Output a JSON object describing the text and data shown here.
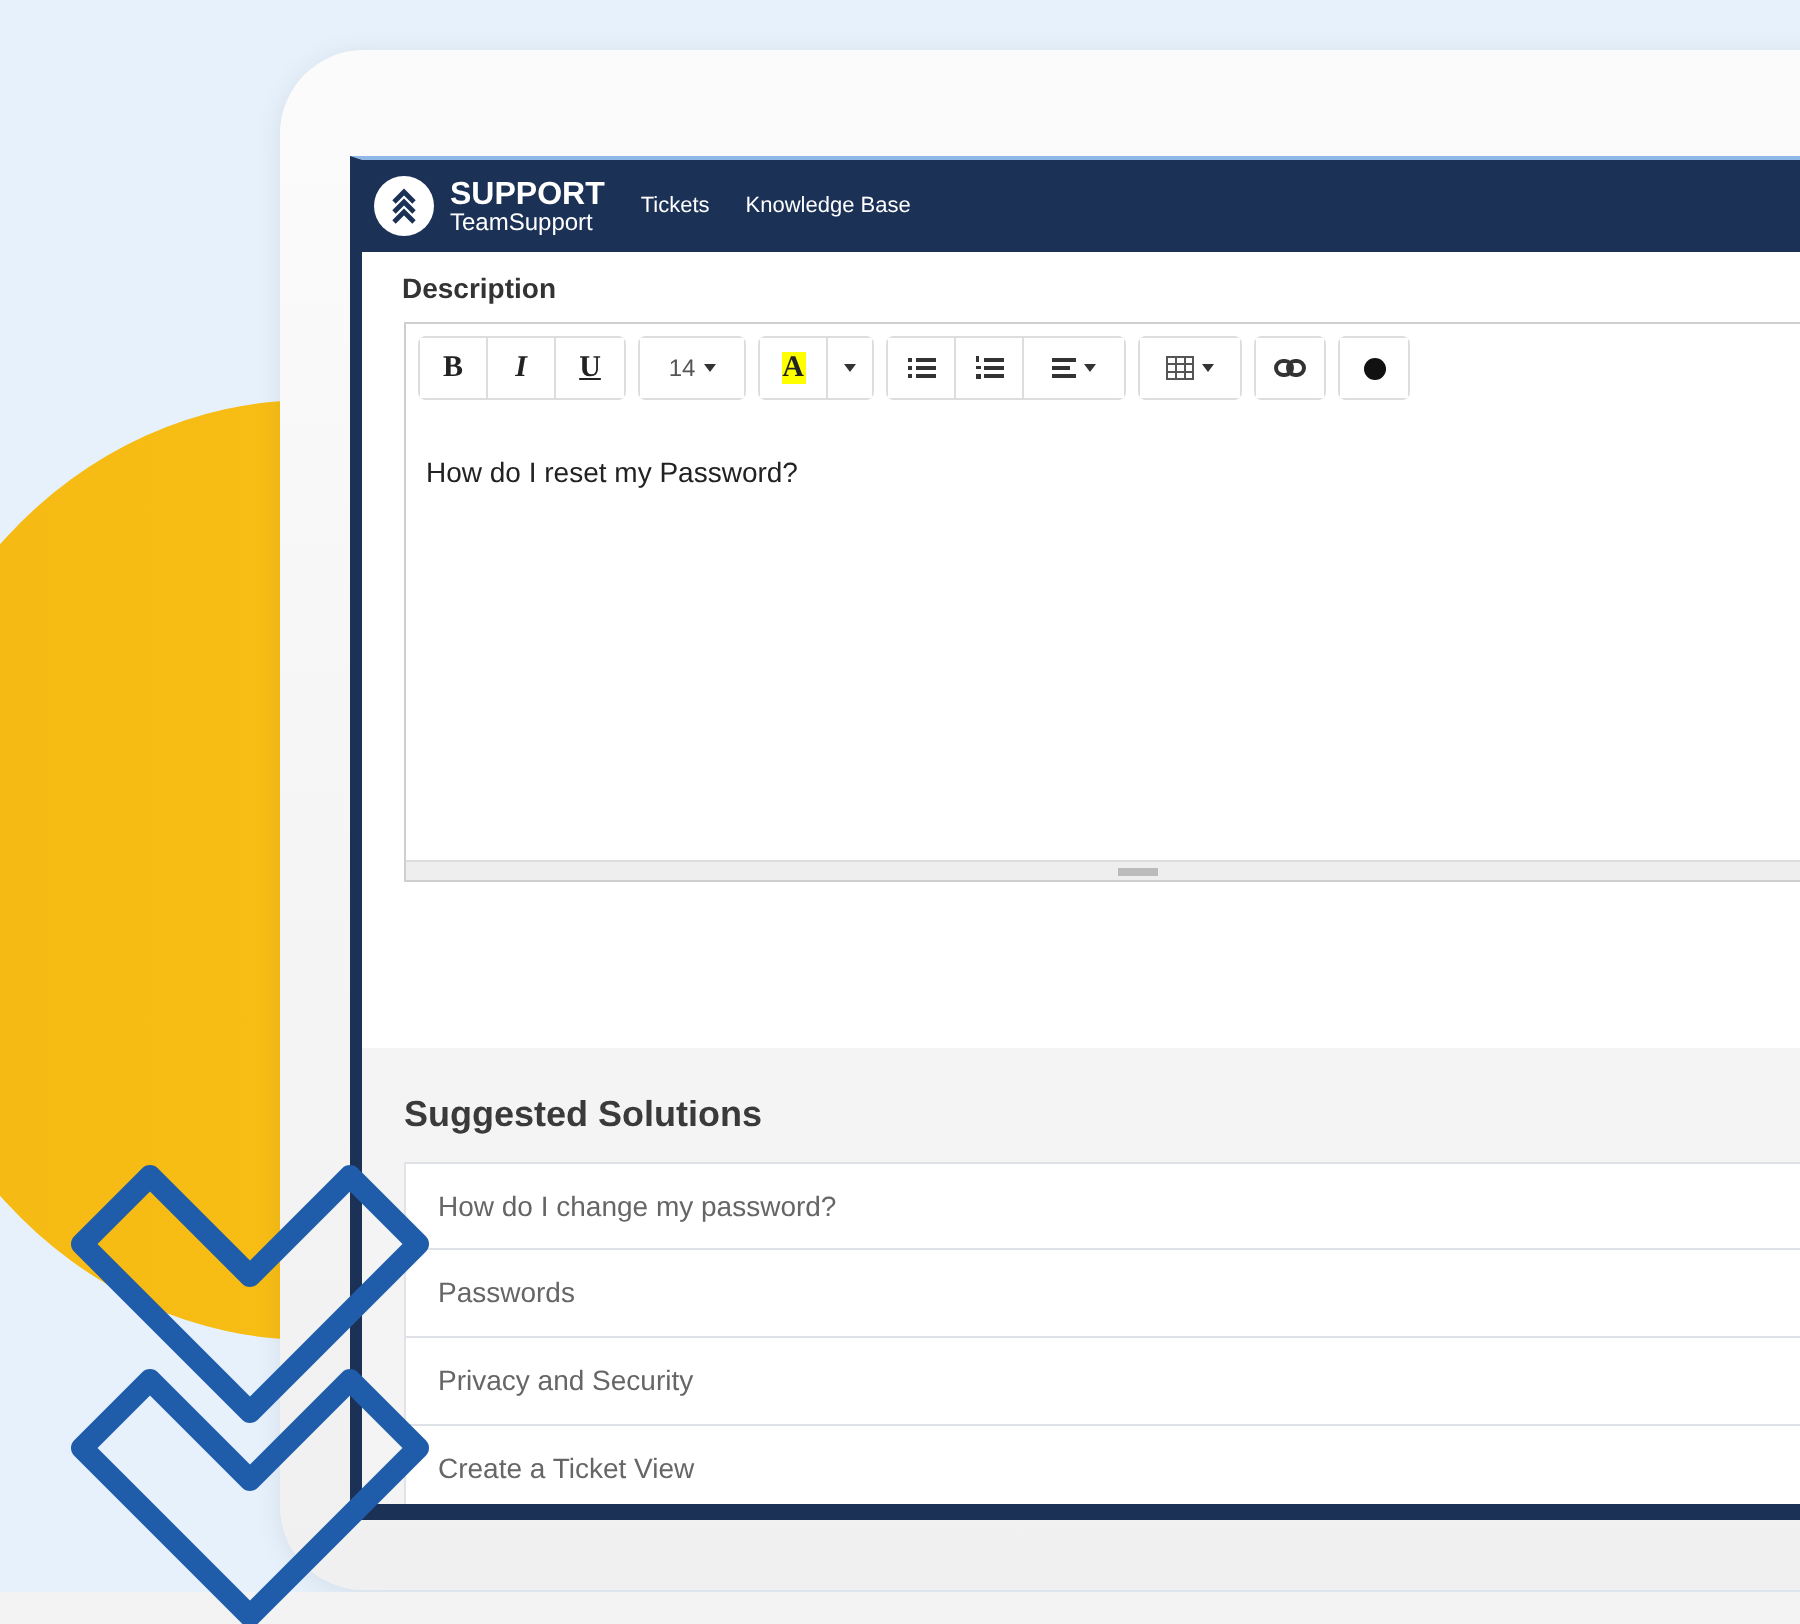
{
  "navbar": {
    "brand": {
      "name": "SUPPORT",
      "sub": "TeamSupport"
    },
    "links": [
      {
        "label": "Tickets"
      },
      {
        "label": "Knowledge Base"
      }
    ]
  },
  "description": {
    "label": "Description",
    "toolbar": [
      {
        "buttons": [
          {
            "kind": "bold",
            "label": "B"
          },
          {
            "kind": "italic",
            "label": "I"
          },
          {
            "kind": "underline",
            "label": "U"
          }
        ]
      },
      {
        "buttons": [
          {
            "kind": "size",
            "label": "14"
          }
        ]
      },
      {
        "buttons": [
          {
            "kind": "color",
            "label": "A",
            "color": "#ffff00"
          },
          {
            "kind": "caret"
          }
        ]
      },
      {
        "buttons": [
          {
            "kind": "bullets"
          },
          {
            "kind": "numbers"
          },
          {
            "kind": "align"
          }
        ]
      },
      {
        "buttons": [
          {
            "kind": "table"
          }
        ]
      },
      {
        "buttons": [
          {
            "kind": "link"
          }
        ]
      },
      {
        "buttons": [
          {
            "kind": "record"
          }
        ]
      }
    ],
    "value": "How do I reset my Password?"
  },
  "suggested_solutions": {
    "title": "Suggested Solutions",
    "items": [
      {
        "label": "How do I change my password?"
      },
      {
        "label": "Passwords"
      },
      {
        "label": "Privacy and Security"
      },
      {
        "label": "Create a Ticket View"
      }
    ]
  }
}
